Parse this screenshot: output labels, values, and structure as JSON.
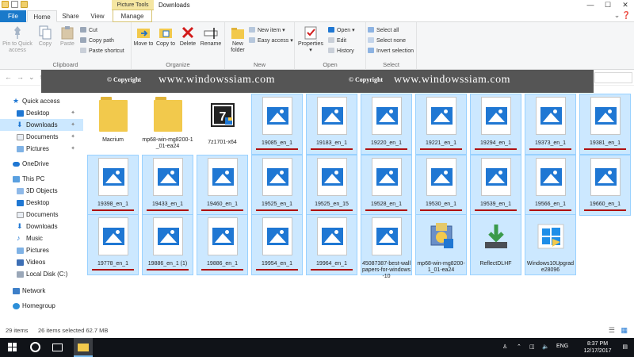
{
  "window": {
    "title": "Downloads",
    "context_tab": "Picture Tools"
  },
  "tabs": [
    {
      "label": "File"
    },
    {
      "label": "Home"
    },
    {
      "label": "Share"
    },
    {
      "label": "View"
    },
    {
      "label": "Manage"
    }
  ],
  "ribbon": {
    "clipboard": {
      "label": "Clipboard",
      "pin": "Pin to Quick access",
      "copy": "Copy",
      "paste": "Paste",
      "cut": "Cut",
      "copy_path": "Copy path",
      "paste_shortcut": "Paste shortcut"
    },
    "organize": {
      "label": "Organize",
      "move_to": "Move to",
      "copy_to": "Copy to",
      "delete": "Delete",
      "rename": "Rename"
    },
    "new": {
      "label": "New",
      "new_folder": "New folder",
      "new_item": "New item",
      "easy_access": "Easy access"
    },
    "open": {
      "label": "Open",
      "properties": "Properties",
      "open": "Open",
      "edit": "Edit",
      "history": "History"
    },
    "select": {
      "label": "Select",
      "select_all": "Select all",
      "select_none": "Select none",
      "invert_selection": "Invert selection"
    }
  },
  "banner": {
    "copyright1": "© Copyright",
    "url1": "www.windowssiam.com",
    "copyright2": "© Copyright",
    "url2": "www.windowssiam.com"
  },
  "sidebar": {
    "items": [
      {
        "label": "Quick access"
      },
      {
        "label": "Desktop"
      },
      {
        "label": "Downloads"
      },
      {
        "label": "Documents"
      },
      {
        "label": "Pictures"
      },
      {
        "label": "OneDrive"
      },
      {
        "label": "This PC"
      },
      {
        "label": "3D Objects"
      },
      {
        "label": "Desktop"
      },
      {
        "label": "Documents"
      },
      {
        "label": "Downloads"
      },
      {
        "label": "Music"
      },
      {
        "label": "Pictures"
      },
      {
        "label": "Videos"
      },
      {
        "label": "Local Disk (C:)"
      },
      {
        "label": "Network"
      },
      {
        "label": "Homegroup"
      }
    ]
  },
  "files": [
    {
      "name": "Macrium",
      "type": "folder"
    },
    {
      "name": "mp68-win-mg8200-1_01-ea24",
      "type": "folder"
    },
    {
      "name": "7z1701-x64",
      "type": "exe7z"
    },
    {
      "name": "19085_en_1",
      "type": "image"
    },
    {
      "name": "19183_en_1",
      "type": "image"
    },
    {
      "name": "19220_en_1",
      "type": "image"
    },
    {
      "name": "19221_en_1",
      "type": "image"
    },
    {
      "name": "19294_en_1",
      "type": "image"
    },
    {
      "name": "19373_en_1",
      "type": "image"
    },
    {
      "name": "19381_en_1",
      "type": "image"
    },
    {
      "name": "19398_en_1",
      "type": "image"
    },
    {
      "name": "19433_en_1",
      "type": "image"
    },
    {
      "name": "19460_en_1",
      "type": "image"
    },
    {
      "name": "19525_en_1",
      "type": "image"
    },
    {
      "name": "19525_en_15",
      "type": "image"
    },
    {
      "name": "19528_en_1",
      "type": "image"
    },
    {
      "name": "19530_en_1",
      "type": "image"
    },
    {
      "name": "19539_en_1",
      "type": "image"
    },
    {
      "name": "19566_en_1",
      "type": "image"
    },
    {
      "name": "19660_en_1",
      "type": "image"
    },
    {
      "name": "19778_en_1",
      "type": "image"
    },
    {
      "name": "19886_en_1 (1)",
      "type": "image"
    },
    {
      "name": "19886_en_1",
      "type": "image"
    },
    {
      "name": "19954_en_1",
      "type": "image"
    },
    {
      "name": "19964_en_1",
      "type": "image"
    },
    {
      "name": "45087387-best-wallpapers-for-windows-10",
      "type": "image"
    },
    {
      "name": "mp68-win-mg8200-1_01-ea24",
      "type": "installer"
    },
    {
      "name": "ReflectDLHF",
      "type": "download"
    },
    {
      "name": "Windows10Upgrade28096",
      "type": "win-upgrade"
    }
  ],
  "status": {
    "items": "29 items",
    "selected": "26 items selected  62.7 MB"
  },
  "taskbar": {
    "lang": "ENG",
    "time": "8:37 PM",
    "date": "12/17/2017"
  },
  "colors": {
    "selection": "#cce8ff",
    "accent": "#1979ca",
    "image_icon": "#1f77d3",
    "banner": "#555555",
    "underline": "#b01010"
  }
}
